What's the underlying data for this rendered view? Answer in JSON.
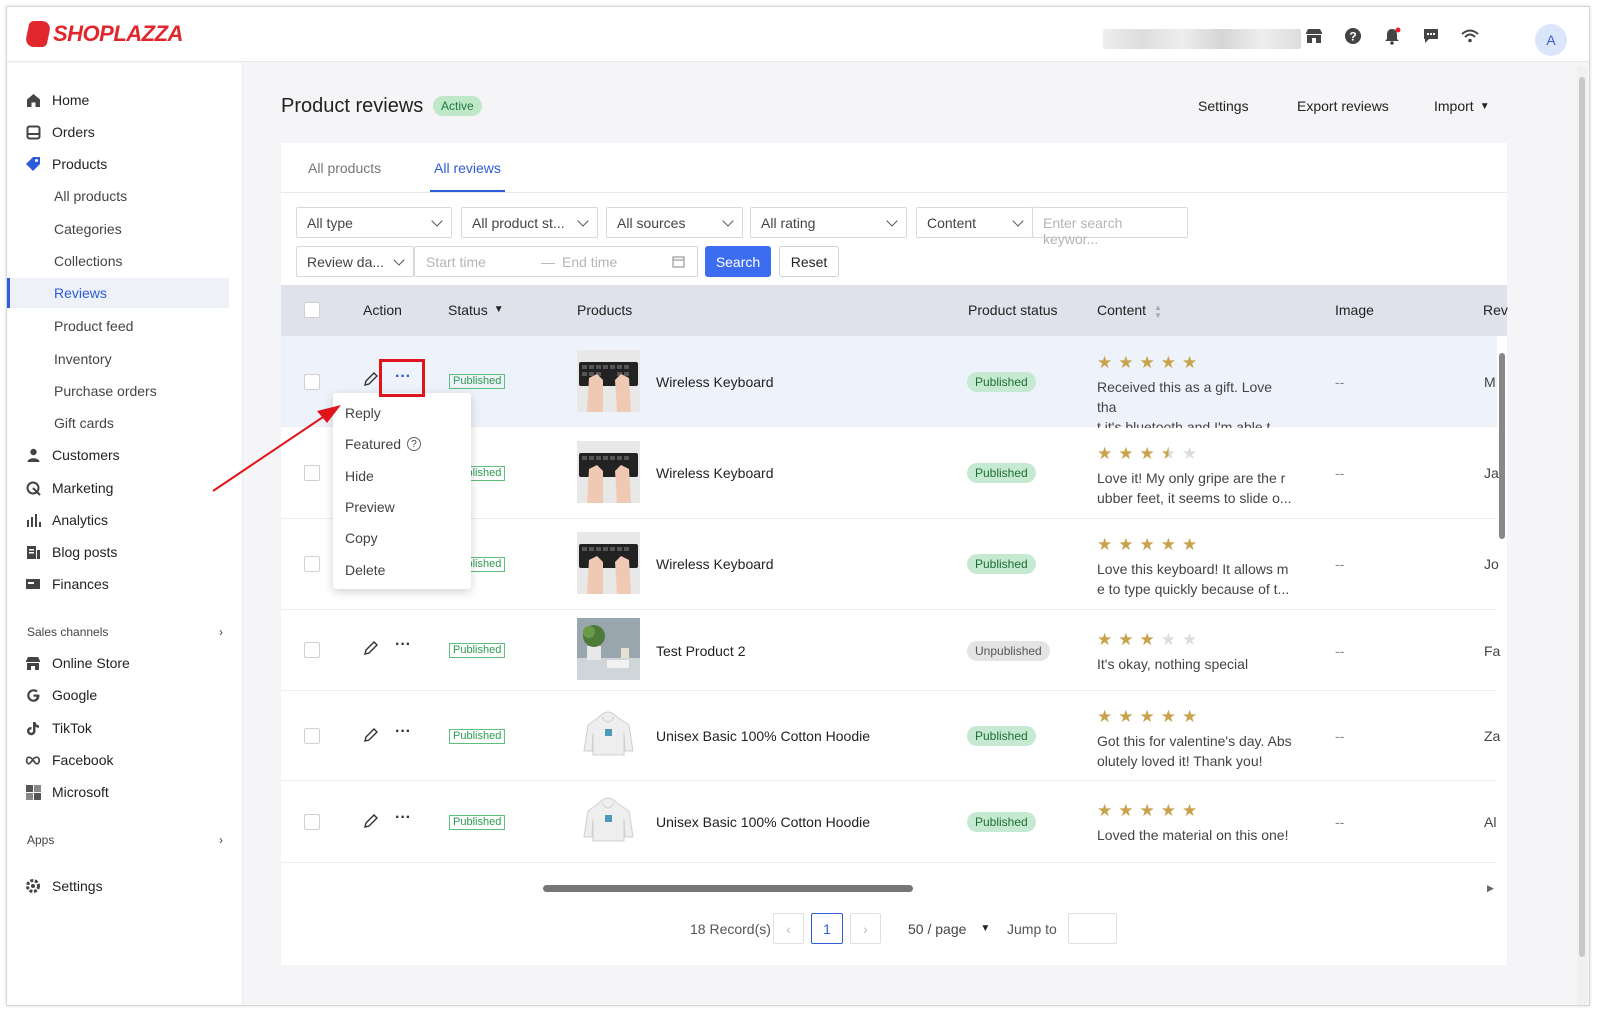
{
  "brand": {
    "name": "SHOPLAZZA",
    "color": "#e0272d"
  },
  "topbar": {
    "icons": [
      "store-icon",
      "help-icon",
      "bell-icon",
      "message-icon",
      "wifi-icon"
    ],
    "avatar": "A"
  },
  "sidebar": {
    "items": [
      {
        "label": "Home",
        "icon": "home-icon"
      },
      {
        "label": "Orders",
        "icon": "orders-icon"
      },
      {
        "label": "Products",
        "icon": "tag-icon"
      },
      {
        "label": "All products"
      },
      {
        "label": "Categories"
      },
      {
        "label": "Collections"
      },
      {
        "label": "Reviews"
      },
      {
        "label": "Product feed"
      },
      {
        "label": "Inventory"
      },
      {
        "label": "Purchase orders"
      },
      {
        "label": "Gift cards"
      },
      {
        "label": "Customers",
        "icon": "person-icon"
      },
      {
        "label": "Marketing",
        "icon": "marketing-icon"
      },
      {
        "label": "Analytics",
        "icon": "bar-chart-icon"
      },
      {
        "label": "Blog posts",
        "icon": "blog-icon"
      },
      {
        "label": "Finances",
        "icon": "finance-icon"
      }
    ],
    "sales_channels_label": "Sales channels",
    "channels": [
      {
        "label": "Online Store",
        "icon": "store-icon"
      },
      {
        "label": "Google",
        "icon": "google-icon"
      },
      {
        "label": "TikTok",
        "icon": "tiktok-icon"
      },
      {
        "label": "Facebook",
        "icon": "meta-icon"
      },
      {
        "label": "Microsoft",
        "icon": "microsoft-icon"
      }
    ],
    "apps_label": "Apps",
    "settings_label": "Settings"
  },
  "header": {
    "title": "Product reviews",
    "badge": "Active",
    "settings": "Settings",
    "export": "Export reviews",
    "import": "Import"
  },
  "tabs": [
    "All products",
    "All reviews"
  ],
  "filters": {
    "type": "All type",
    "product_status": "All product st...",
    "sources": "All sources",
    "rating": "All rating",
    "content": "Content",
    "search_placeholder": "Enter search keywor...",
    "date_type": "Review da...",
    "start_placeholder": "Start time",
    "end_placeholder": "End time",
    "search_button": "Search",
    "reset_button": "Reset"
  },
  "table": {
    "columns": [
      "Action",
      "Status",
      "Products",
      "Product status",
      "Content",
      "Image",
      "Rev"
    ],
    "rows": [
      {
        "status": "Published",
        "product": "Wireless Keyboard",
        "product_status": "Published",
        "rating": 5,
        "content": [
          "Received this as a gift. Love tha",
          "t it's bluetooth and I'm able t..."
        ],
        "image": "--",
        "reviewer": "M"
      },
      {
        "status": "Published",
        "product": "Wireless Keyboard",
        "product_status": "Published",
        "rating": 3.5,
        "content": [
          "Love it! My only gripe are the r",
          "ubber feet, it seems to slide o..."
        ],
        "image": "--",
        "reviewer": "Ja"
      },
      {
        "status": "Published",
        "product": "Wireless Keyboard",
        "product_status": "Published",
        "rating": 5,
        "content": [
          "Love this keyboard! It allows m",
          "e to type quickly because of t..."
        ],
        "image": "--",
        "reviewer": "Jo"
      },
      {
        "status": "Published",
        "product": "Test Product 2",
        "product_status": "Unpublished",
        "rating": 3,
        "content": [
          "It's okay, nothing special"
        ],
        "image": "--",
        "reviewer": "Fa"
      },
      {
        "status": "Published",
        "product": "Unisex Basic 100% Cotton Hoodie",
        "product_status": "Published",
        "rating": 5,
        "content": [
          "Got this for valentine's day. Abs",
          "olutely loved it! Thank you!"
        ],
        "image": "--",
        "reviewer": "Za"
      },
      {
        "status": "Published",
        "product": "Unisex Basic 100% Cotton Hoodie",
        "product_status": "Published",
        "rating": 5,
        "content": [
          "Loved the material on this one!"
        ],
        "image": "--",
        "reviewer": "Al"
      }
    ]
  },
  "action_menu": [
    "Reply",
    "Featured",
    "Hide",
    "Preview",
    "Copy",
    "Delete"
  ],
  "pagination": {
    "records": "18 Record(s)",
    "page": "1",
    "page_size": "50 / page",
    "jump_label": "Jump to"
  }
}
